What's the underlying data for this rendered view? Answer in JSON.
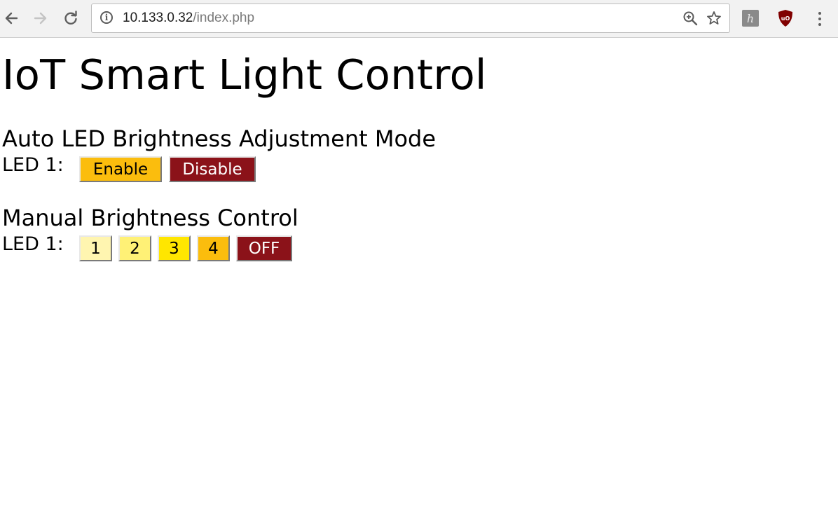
{
  "browser": {
    "url_host": "10.133.0.32",
    "url_path": "/index.php",
    "back_icon": "arrow-left-icon",
    "forward_icon": "arrow-right-icon",
    "reload_icon": "reload-icon",
    "info_icon": "info-icon",
    "info_glyph": "i",
    "zoom_icon": "zoom-icon",
    "bookmark_icon": "star-icon",
    "extension_h_glyph": "h",
    "extension_ublock_glyph": "uO",
    "menu_icon": "three-dots-icon"
  },
  "page": {
    "title": "IoT Smart Light Control",
    "auto_section": {
      "heading": "Auto LED Brightness Adjustment Mode",
      "row_label": "LED 1:",
      "buttons": [
        {
          "label": "Enable",
          "color": "#fbbd0d",
          "text_color": "#000000"
        },
        {
          "label": "Disable",
          "color": "#8b1219",
          "text_color": "#ffffff"
        }
      ]
    },
    "manual_section": {
      "heading": "Manual Brightness Control",
      "row_label": "LED 1:",
      "buttons": [
        {
          "label": "1",
          "color": "#fff5b0",
          "text_color": "#000000"
        },
        {
          "label": "2",
          "color": "#fff176",
          "text_color": "#000000"
        },
        {
          "label": "3",
          "color": "#ffe600",
          "text_color": "#000000"
        },
        {
          "label": "4",
          "color": "#fbbd0d",
          "text_color": "#000000"
        },
        {
          "label": "OFF",
          "color": "#8b1219",
          "text_color": "#ffffff"
        }
      ]
    }
  }
}
